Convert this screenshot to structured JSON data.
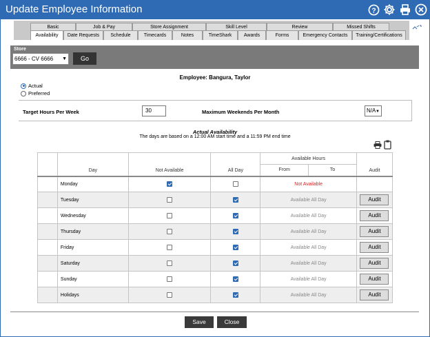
{
  "window": {
    "title": "Update Employee Information",
    "icons": [
      "help-icon",
      "gear-icon",
      "print-icon",
      "close-icon"
    ]
  },
  "tabs": {
    "row1": [
      "Basic",
      "Job & Pay",
      "Store Assignment",
      "Skill Level",
      "Review",
      "Missed Shifts"
    ],
    "row2": [
      "Availability",
      "Date Requests",
      "Schedule",
      "Timecards",
      "Notes",
      "TimeShark",
      "Awards",
      "Forms",
      "Emergency Contacts",
      "Training/Certifications"
    ],
    "active": "Availability"
  },
  "store": {
    "label": "Store",
    "selected": "6666 - CV 6666",
    "go_label": "Go"
  },
  "employee_label": "Employee: Bangura, Taylor",
  "radios": {
    "actual": "Actual",
    "preferred": "Preferred",
    "selected": "Actual"
  },
  "hours": {
    "target_label": "Target Hours Per Week",
    "target_value": "30",
    "weekends_label": "Maximum Weekends Per Month",
    "weekends_value": "N/A"
  },
  "availability": {
    "title": "Actual Availability",
    "subtitle": "The days are based on a 12:00 AM start time and a 11:59 PM end time"
  },
  "table": {
    "headers": {
      "day": "Day",
      "not_available": "Not Available",
      "all_day": "All Day",
      "available_hours": "Available Hours",
      "from": "From",
      "to": "To",
      "audit": "Audit"
    },
    "rows": [
      {
        "day": "Monday",
        "not_available": true,
        "all_day": false,
        "hours": "Not Available",
        "audit": ""
      },
      {
        "day": "Tuesday",
        "not_available": false,
        "all_day": true,
        "hours": "Available All Day",
        "audit": "Audit"
      },
      {
        "day": "Wednesday",
        "not_available": false,
        "all_day": true,
        "hours": "Available All Day",
        "audit": "Audit"
      },
      {
        "day": "Thursday",
        "not_available": false,
        "all_day": true,
        "hours": "Available All Day",
        "audit": "Audit"
      },
      {
        "day": "Friday",
        "not_available": false,
        "all_day": true,
        "hours": "Available All Day",
        "audit": "Audit"
      },
      {
        "day": "Saturday",
        "not_available": false,
        "all_day": true,
        "hours": "Available All Day",
        "audit": "Audit"
      },
      {
        "day": "Sunday",
        "not_available": false,
        "all_day": true,
        "hours": "Available All Day",
        "audit": "Audit"
      },
      {
        "day": "Holidays",
        "not_available": false,
        "all_day": true,
        "hours": "Available All Day",
        "audit": "Audit"
      }
    ]
  },
  "footer": {
    "save_label": "Save",
    "close_label": "Close"
  },
  "colors": {
    "title_bar": "#2f6bb5",
    "not_available_text": "#e02020"
  }
}
